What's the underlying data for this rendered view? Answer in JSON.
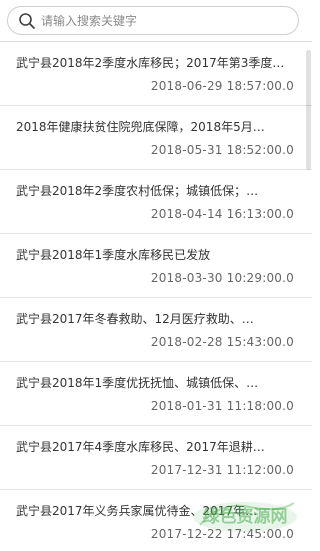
{
  "search": {
    "placeholder": "请输入搜索关键字",
    "value": ""
  },
  "news": [
    {
      "title": "武宁县2018年2季度水库移民；2017年第3季度…",
      "date": "2018-06-29 18:57:00.0"
    },
    {
      "title": "2018年健康扶贫住院兜底保障，2018年5月…",
      "date": "2018-05-31 18:52:00.0"
    },
    {
      "title": "武宁县2018年2季度农村低保；城镇低保；…",
      "date": "2018-04-14 16:13:00.0"
    },
    {
      "title": "武宁县2018年1季度水库移民已发放",
      "date": "2018-03-30 10:29:00.0"
    },
    {
      "title": "武宁县2017年冬春救助、12月医疗救助、…",
      "date": "2018-02-28 15:43:00.0"
    },
    {
      "title": "武宁县2018年1季度优抚抚恤、城镇低保、…",
      "date": "2018-01-31 11:18:00.0"
    },
    {
      "title": "武宁县2017年4季度水库移民、2017年退耕…",
      "date": "2017-12-31 11:12:00.0"
    },
    {
      "title": "武宁县2017年义务兵家属优待金、2017年…",
      "date": "2017-12-22 17:45:00.0"
    }
  ],
  "watermark": {
    "text": "绿色资源网",
    "color": "#4caf50"
  },
  "icons": {
    "search": "search-icon"
  }
}
